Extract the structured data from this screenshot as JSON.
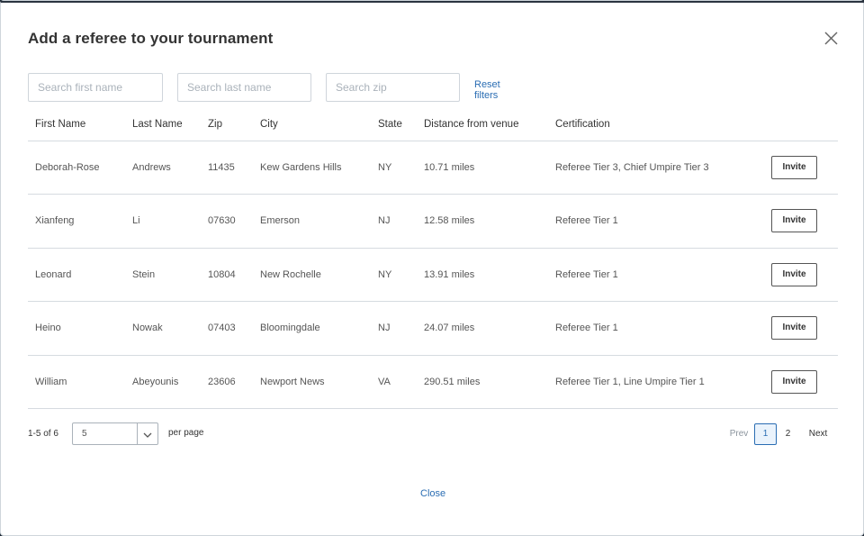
{
  "modal": {
    "title": "Add a referee to your tournament",
    "close_link": "Close"
  },
  "filters": {
    "first_name_placeholder": "Search first name",
    "last_name_placeholder": "Search last name",
    "zip_placeholder": "Search zip",
    "reset_label": "Reset filters"
  },
  "table": {
    "headers": [
      "First Name",
      "Last Name",
      "Zip",
      "City",
      "State",
      "Distance from venue",
      "Certification"
    ],
    "rows": [
      {
        "first": "Deborah-Rose",
        "last": "Andrews",
        "zip": "11435",
        "city": "Kew Gardens Hills",
        "state": "NY",
        "distance": "10.71 miles",
        "certification": "Referee Tier 3, Chief Umpire Tier 3",
        "action": "Invite"
      },
      {
        "first": "Xianfeng",
        "last": "Li",
        "zip": "07630",
        "city": "Emerson",
        "state": "NJ",
        "distance": "12.58 miles",
        "certification": "Referee Tier 1",
        "action": "Invite"
      },
      {
        "first": "Leonard",
        "last": "Stein",
        "zip": "10804",
        "city": "New Rochelle",
        "state": "NY",
        "distance": "13.91 miles",
        "certification": "Referee Tier 1",
        "action": "Invite"
      },
      {
        "first": "Heino",
        "last": "Nowak",
        "zip": "07403",
        "city": "Bloomingdale",
        "state": "NJ",
        "distance": "24.07 miles",
        "certification": "Referee Tier 1",
        "action": "Invite"
      },
      {
        "first": "William",
        "last": "Abeyounis",
        "zip": "23606",
        "city": "Newport News",
        "state": "VA",
        "distance": "290.51 miles",
        "certification": "Referee Tier 1, Line Umpire Tier 1",
        "action": "Invite"
      }
    ]
  },
  "pagination": {
    "range": "1-5 of 6",
    "per_page_value": "5",
    "per_page_label": "per page",
    "prev": "Prev",
    "pages": [
      "1",
      "2"
    ],
    "current_page": "1",
    "next": "Next"
  },
  "colors": {
    "accent": "#2a6db3",
    "border": "#d6dbe0"
  }
}
